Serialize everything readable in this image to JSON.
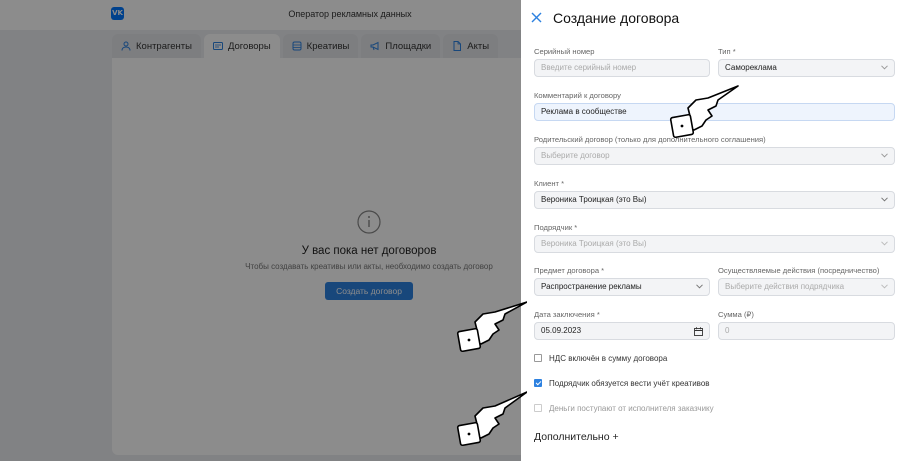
{
  "app": {
    "title": "Оператор рекламных данных",
    "logo_text": "VK",
    "tabs": [
      {
        "label": "Контрагенты",
        "icon": "user-icon"
      },
      {
        "label": "Договоры",
        "icon": "contract-icon"
      },
      {
        "label": "Креативы",
        "icon": "stack-icon"
      },
      {
        "label": "Площадки",
        "icon": "megaphone-icon"
      },
      {
        "label": "Акты",
        "icon": "document-icon"
      }
    ],
    "active_tab": "Договоры",
    "empty_state": {
      "title": "У вас пока нет договоров",
      "subtitle": "Чтобы создавать креативы или акты, необходимо создать договор",
      "button": "Создать договор"
    }
  },
  "panel": {
    "title": "Создание договора",
    "serial": {
      "label": "Серийный номер",
      "placeholder": "Введите серийный номер"
    },
    "type": {
      "label": "Тип *",
      "value": "Самореклама"
    },
    "comment": {
      "label": "Комментарий к договору",
      "value": "Реклама в сообществе"
    },
    "parent": {
      "label": "Родительский договор (только для дополнительного соглашения)",
      "placeholder": "Выберите договор"
    },
    "client": {
      "label": "Клиент *",
      "value": "Вероника Троицкая (это Вы)"
    },
    "contractor": {
      "label": "Подрядчик *",
      "value": "Вероника Троицкая (это Вы)"
    },
    "subject": {
      "label": "Предмет договора *",
      "value": "Распространение рекламы"
    },
    "actions": {
      "label": "Осуществляемые действия (посредничество)",
      "placeholder": "Выберите действия подрядчика"
    },
    "date": {
      "label": "Дата заключения *",
      "value": "05.09.2023"
    },
    "amount": {
      "label": "Сумма (₽)",
      "placeholder": "0"
    },
    "checkboxes": [
      {
        "label": "НДС включён в сумму договора",
        "checked": false
      },
      {
        "label": "Подрядчик обязуется вести учёт креативов",
        "checked": true
      },
      {
        "label": "Деньги поступают от исполнителя заказчику",
        "checked": false
      }
    ],
    "more": "Дополнительно +"
  },
  "colors": {
    "accent": "#2d81e0",
    "vk_blue": "#0077ff",
    "overlay": "rgba(0,0,0,0.45)"
  }
}
